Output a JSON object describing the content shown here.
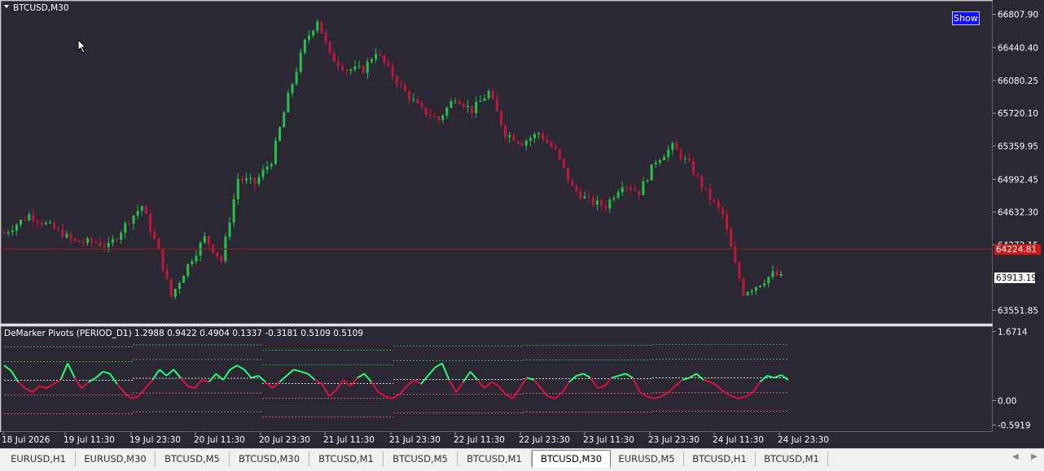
{
  "symbol_label": "BTCUSD,M30",
  "show_button": "Show",
  "colors": {
    "bg": "#2b2733",
    "up": "#27c24c",
    "down": "#c0183c",
    "grid_border": "#9a9a9a",
    "hline": "#9b1b1b",
    "dem_up": "#22ff77",
    "dem_down": "#e01040"
  },
  "chart_data": [
    {
      "type": "candlestick",
      "title": "BTCUSD,M30",
      "ylim": [
        63430,
        66930
      ],
      "y_ticks": [
        "66807.90",
        "66440.40",
        "66080.25",
        "65720.10",
        "65359.95",
        "64992.45",
        "64632.30",
        "64272.15",
        "63913.19",
        "63551.85"
      ],
      "current_price": "63913.19",
      "hline_price": "64224.81",
      "x_ticks": [
        "18 Jul 2026",
        "19 Jul 11:30",
        "19 Jul 23:30",
        "20 Jul 11:30",
        "20 Jul 23:30",
        "21 Jul 11:30",
        "21 Jul 23:30",
        "22 Jul 11:30",
        "22 Jul 23:30",
        "23 Jul 11:30",
        "23 Jul 23:30",
        "24 Jul 11:30",
        "24 Jul 23:30"
      ],
      "close_path": [
        [
          0,
          64400
        ],
        [
          6,
          64600
        ],
        [
          12,
          64450
        ],
        [
          17,
          64300
        ],
        [
          22,
          64300
        ],
        [
          25,
          64250
        ],
        [
          30,
          64550
        ],
        [
          33,
          64700
        ],
        [
          37,
          64200
        ],
        [
          40,
          63700
        ],
        [
          44,
          64050
        ],
        [
          48,
          64350
        ],
        [
          52,
          64100
        ],
        [
          56,
          65000
        ],
        [
          60,
          64950
        ],
        [
          64,
          65200
        ],
        [
          68,
          65900
        ],
        [
          72,
          66500
        ],
        [
          75,
          66750
        ],
        [
          78,
          66350
        ],
        [
          82,
          66200
        ],
        [
          86,
          66200
        ],
        [
          89,
          66400
        ],
        [
          92,
          66200
        ],
        [
          96,
          65950
        ],
        [
          100,
          65750
        ],
        [
          104,
          65650
        ],
        [
          108,
          65900
        ],
        [
          112,
          65750
        ],
        [
          116,
          65950
        ],
        [
          120,
          65500
        ],
        [
          124,
          65400
        ],
        [
          128,
          65500
        ],
        [
          132,
          65300
        ],
        [
          136,
          64900
        ],
        [
          140,
          64750
        ],
        [
          144,
          64700
        ],
        [
          148,
          64950
        ],
        [
          152,
          64850
        ],
        [
          156,
          65200
        ],
        [
          160,
          65350
        ],
        [
          164,
          65150
        ],
        [
          168,
          64850
        ],
        [
          172,
          64600
        ],
        [
          175,
          64050
        ],
        [
          177,
          63750
        ],
        [
          180,
          63820
        ],
        [
          184,
          63950
        ],
        [
          186,
          63913
        ]
      ]
    },
    {
      "type": "line",
      "title": "DeMarker Pivots (PERIOD_D1) 1.2988 0.9422 0.4904 0.1337 -0.3181 0.5109 0.5109",
      "ylim": [
        -0.7,
        1.72
      ],
      "y_ticks": [
        "1.6714",
        "0.00",
        "-0.5919"
      ],
      "series": [
        {
          "values": [
            0.85,
            0.72,
            0.45,
            0.3,
            0.2,
            0.35,
            0.3,
            0.4,
            0.5,
            0.9,
            0.55,
            0.3,
            0.45,
            0.55,
            0.7,
            0.65,
            0.4,
            0.2,
            0.05,
            0.1,
            0.3,
            0.5,
            0.75,
            0.6,
            0.75,
            0.55,
            0.35,
            0.3,
            0.5,
            0.45,
            0.65,
            0.5,
            0.75,
            0.85,
            0.75,
            0.55,
            0.6,
            0.45,
            0.3,
            0.45,
            0.6,
            0.75,
            0.7,
            0.65,
            0.5,
            0.4,
            0.1,
            0.25,
            0.5,
            0.35,
            0.55,
            0.65,
            0.45,
            0.2,
            0.1,
            0.05,
            0.15,
            0.35,
            0.5,
            0.4,
            0.6,
            0.8,
            0.9,
            0.5,
            0.2,
            0.45,
            0.7,
            0.5,
            0.3,
            0.45,
            0.35,
            0.15,
            0.05,
            0.3,
            0.55,
            0.5,
            0.3,
            0.1,
            0.05,
            0.2,
            0.45,
            0.6,
            0.65,
            0.55,
            0.3,
            0.35,
            0.55,
            0.6,
            0.65,
            0.55,
            0.2,
            0.1,
            0.05,
            0.1,
            0.2,
            0.35,
            0.5,
            0.55,
            0.65,
            0.5,
            0.45,
            0.35,
            0.2,
            0.1,
            0.05,
            0.1,
            0.2,
            0.45,
            0.6,
            0.55,
            0.62,
            0.5
          ]
        }
      ],
      "pivot_levels": {
        "r2": 1.2988,
        "r1": 0.9422,
        "p": 0.4904,
        "s1": 0.1337,
        "s2": -0.3181
      }
    }
  ],
  "tabs": [
    {
      "label": "EURUSD,H1",
      "active": false
    },
    {
      "label": "EURUSD,M30",
      "active": false
    },
    {
      "label": "BTCUSD,M5",
      "active": false
    },
    {
      "label": "BTCUSD,M30",
      "active": false
    },
    {
      "label": "BTCUSD,M1",
      "active": false
    },
    {
      "label": "BTCUSD,M5",
      "active": false
    },
    {
      "label": "BTCUSD,M1",
      "active": false
    },
    {
      "label": "BTCUSD,M30",
      "active": true
    },
    {
      "label": "EURUSD,M5",
      "active": false
    },
    {
      "label": "BTCUSD,H1",
      "active": false
    },
    {
      "label": "BTCUSD,M1",
      "active": false
    }
  ]
}
